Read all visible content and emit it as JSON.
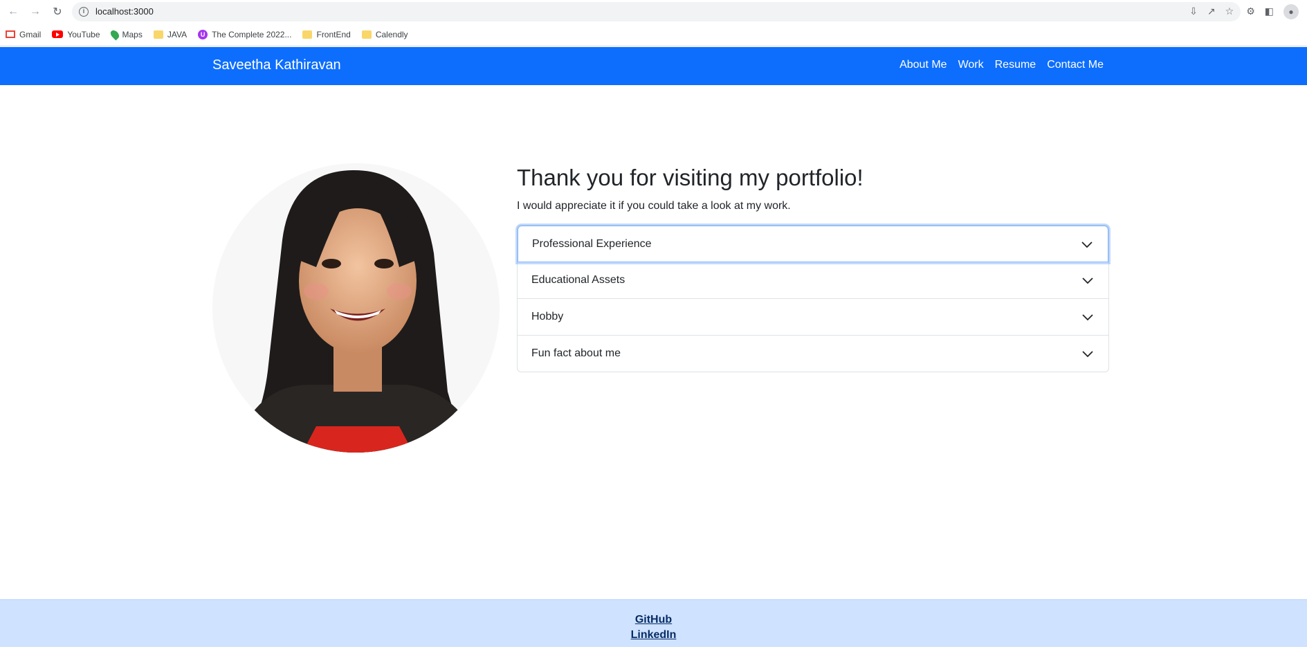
{
  "browser": {
    "url": "localhost:3000",
    "bookmarks": [
      {
        "label": "Gmail",
        "icon": "gmail-icon"
      },
      {
        "label": "YouTube",
        "icon": "youtube-icon"
      },
      {
        "label": "Maps",
        "icon": "maps-icon"
      },
      {
        "label": "JAVA",
        "icon": "folder-icon"
      },
      {
        "label": "The Complete 2022...",
        "icon": "udemy-icon"
      },
      {
        "label": "FrontEnd",
        "icon": "folder-icon"
      },
      {
        "label": "Calendly",
        "icon": "folder-icon"
      }
    ]
  },
  "navbar": {
    "brand": "Saveetha Kathiravan",
    "links": [
      "About Me",
      "Work",
      "Resume",
      "Contact Me"
    ],
    "color": "#0d6efd"
  },
  "main": {
    "heading": "Thank you for visiting my portfolio!",
    "subtext": "I would appreciate it if you could take a look at my work.",
    "accordion": [
      "Professional Experience",
      "Educational Assets",
      "Hobby",
      "Fun fact about me"
    ]
  },
  "footer": {
    "github": "GitHub",
    "linkedin": "LinkedIn"
  }
}
